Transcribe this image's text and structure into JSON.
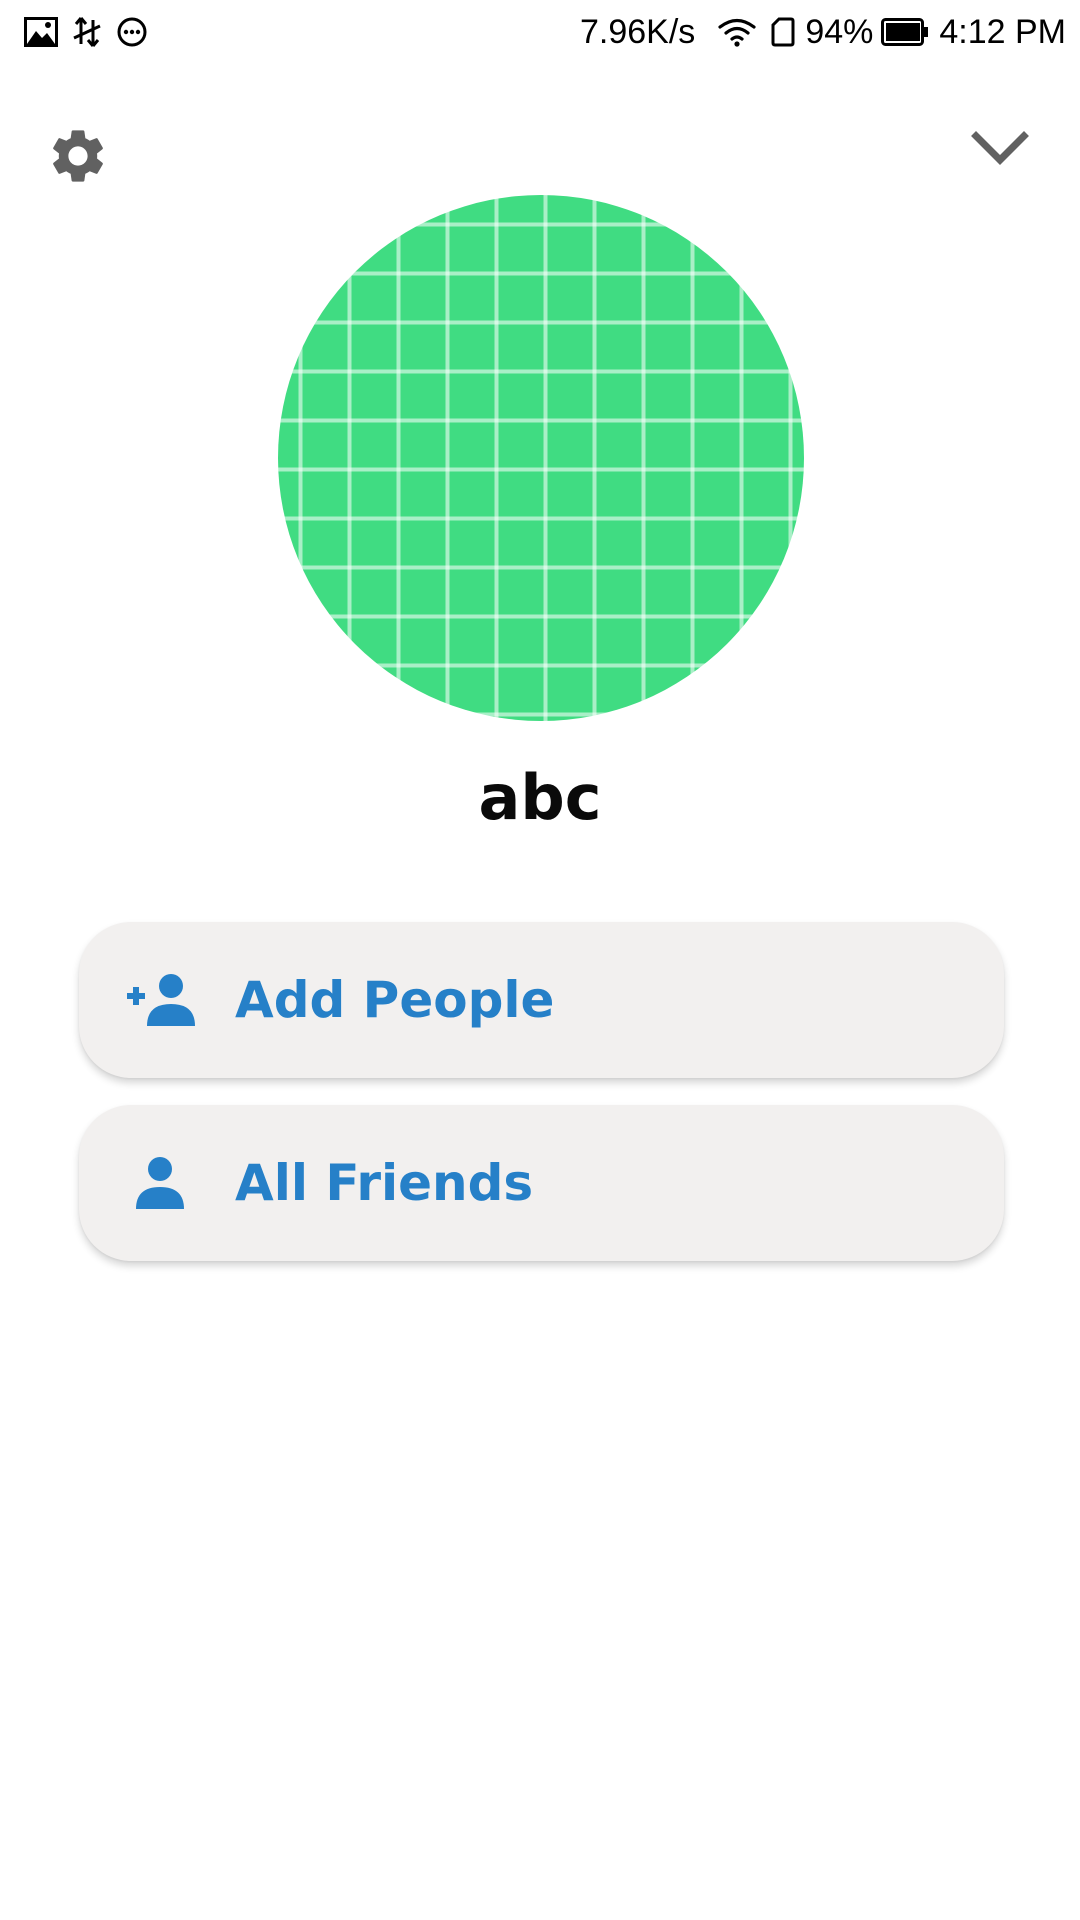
{
  "status_bar": {
    "left_icons": [
      "image-icon",
      "data-sync-icon",
      "chat-bubble-icon"
    ],
    "network_speed": "7.96K/s",
    "battery_percent": "94%",
    "time": "4:12 PM"
  },
  "header": {
    "settings_icon": "gear-icon",
    "collapse_icon": "chevron-down-icon"
  },
  "profile": {
    "avatar_color": "#40dc82",
    "name": "abc"
  },
  "actions": [
    {
      "label": "Add People",
      "icon": "person-add-icon"
    },
    {
      "label": "All Friends",
      "icon": "person-icon"
    }
  ],
  "colors": {
    "accent": "#2680c8",
    "card_background": "#f2f0ef",
    "icon_gray": "#616161"
  }
}
